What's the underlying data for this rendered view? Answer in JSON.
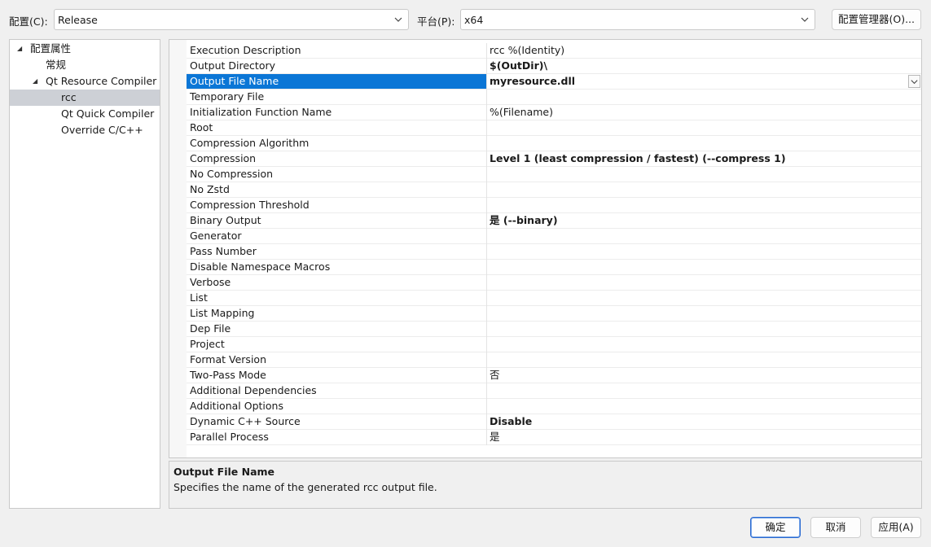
{
  "toolbar": {
    "config_label": "配置(C):",
    "config_value": "Release",
    "platform_label": "平台(P):",
    "platform_value": "x64",
    "config_manager_label": "配置管理器(O)..."
  },
  "tree": {
    "root": "配置属性",
    "items": [
      {
        "label": "常规"
      },
      {
        "label": "Qt Resource Compiler"
      },
      {
        "label": "rcc"
      },
      {
        "label": "Qt Quick Compiler"
      },
      {
        "label": "Override C/C++"
      }
    ]
  },
  "properties": [
    {
      "name": "Execution Description",
      "value": "rcc %(Identity)"
    },
    {
      "name": "Output Directory",
      "value": "$(OutDir)\\"
    },
    {
      "name": "Output File Name",
      "value": "myresource.dll"
    },
    {
      "name": "Temporary File",
      "value": ""
    },
    {
      "name": "Initialization Function Name",
      "value": "%(Filename)"
    },
    {
      "name": "Root",
      "value": ""
    },
    {
      "name": "Compression Algorithm",
      "value": ""
    },
    {
      "name": "Compression",
      "value": "Level 1 (least compression / fastest) (--compress 1)"
    },
    {
      "name": "No Compression",
      "value": ""
    },
    {
      "name": "No Zstd",
      "value": ""
    },
    {
      "name": "Compression Threshold",
      "value": ""
    },
    {
      "name": "Binary Output",
      "value": "是 (--binary)"
    },
    {
      "name": "Generator",
      "value": ""
    },
    {
      "name": "Pass Number",
      "value": ""
    },
    {
      "name": "Disable Namespace Macros",
      "value": ""
    },
    {
      "name": "Verbose",
      "value": ""
    },
    {
      "name": "List",
      "value": ""
    },
    {
      "name": "List Mapping",
      "value": ""
    },
    {
      "name": "Dep File",
      "value": ""
    },
    {
      "name": "Project",
      "value": ""
    },
    {
      "name": "Format Version",
      "value": ""
    },
    {
      "name": "Two-Pass Mode",
      "value": "否"
    },
    {
      "name": "Additional Dependencies",
      "value": ""
    },
    {
      "name": "Additional Options",
      "value": ""
    },
    {
      "name": "Dynamic C++ Source",
      "value": "Disable"
    },
    {
      "name": "Parallel Process",
      "value": "是"
    }
  ],
  "description": {
    "title": "Output File Name",
    "text": "Specifies the name of the generated rcc output file."
  },
  "buttons": {
    "ok": "确定",
    "cancel": "取消",
    "apply": "应用(A)"
  },
  "colors": {
    "selection": "#0b76d6",
    "tree_selection": "#cdd0d6",
    "primary_button_border": "#2a6ad1"
  }
}
